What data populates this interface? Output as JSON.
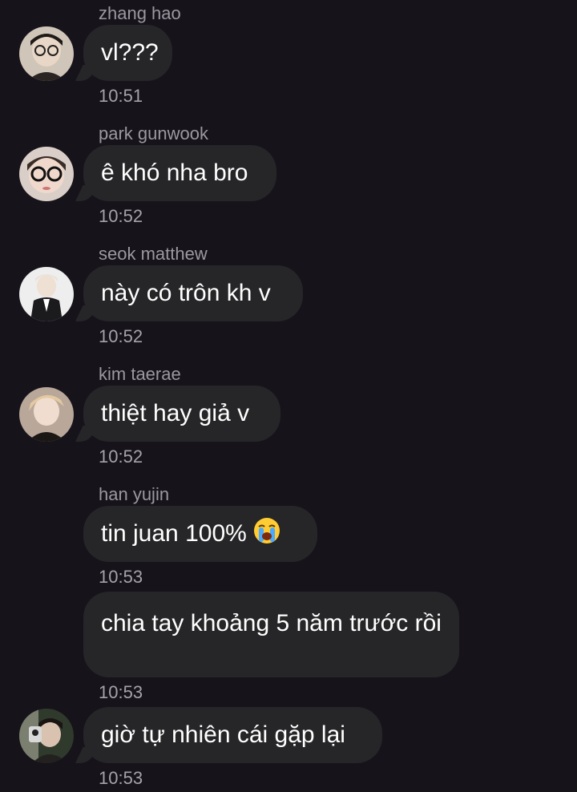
{
  "messages": [
    {
      "sender": "zhang hao",
      "text": "vl???",
      "time": "10:51"
    },
    {
      "sender": "park gunwook",
      "text": "ê khó nha bro",
      "time": "10:52"
    },
    {
      "sender": "seok matthew",
      "text": "này có trôn kh v",
      "time": "10:52"
    },
    {
      "sender": "kim taerae",
      "text": "thiệt hay giả v",
      "time": "10:52"
    },
    {
      "sender": "han yujin",
      "text": "tin juan 100%",
      "emoji": "loudly-crying-face-icon",
      "time": "10:53"
    },
    {
      "text": "chia tay khoảng 5 năm trước rồi",
      "time": "10:53"
    },
    {
      "text": "giờ tự nhiên cái gặp lại",
      "time": "10:53"
    }
  ],
  "colors": {
    "background": "#16131a",
    "bubble": "#262628",
    "sender_name": "#9b98a1",
    "timestamp": "#a5a2ab",
    "text": "#ffffff"
  }
}
